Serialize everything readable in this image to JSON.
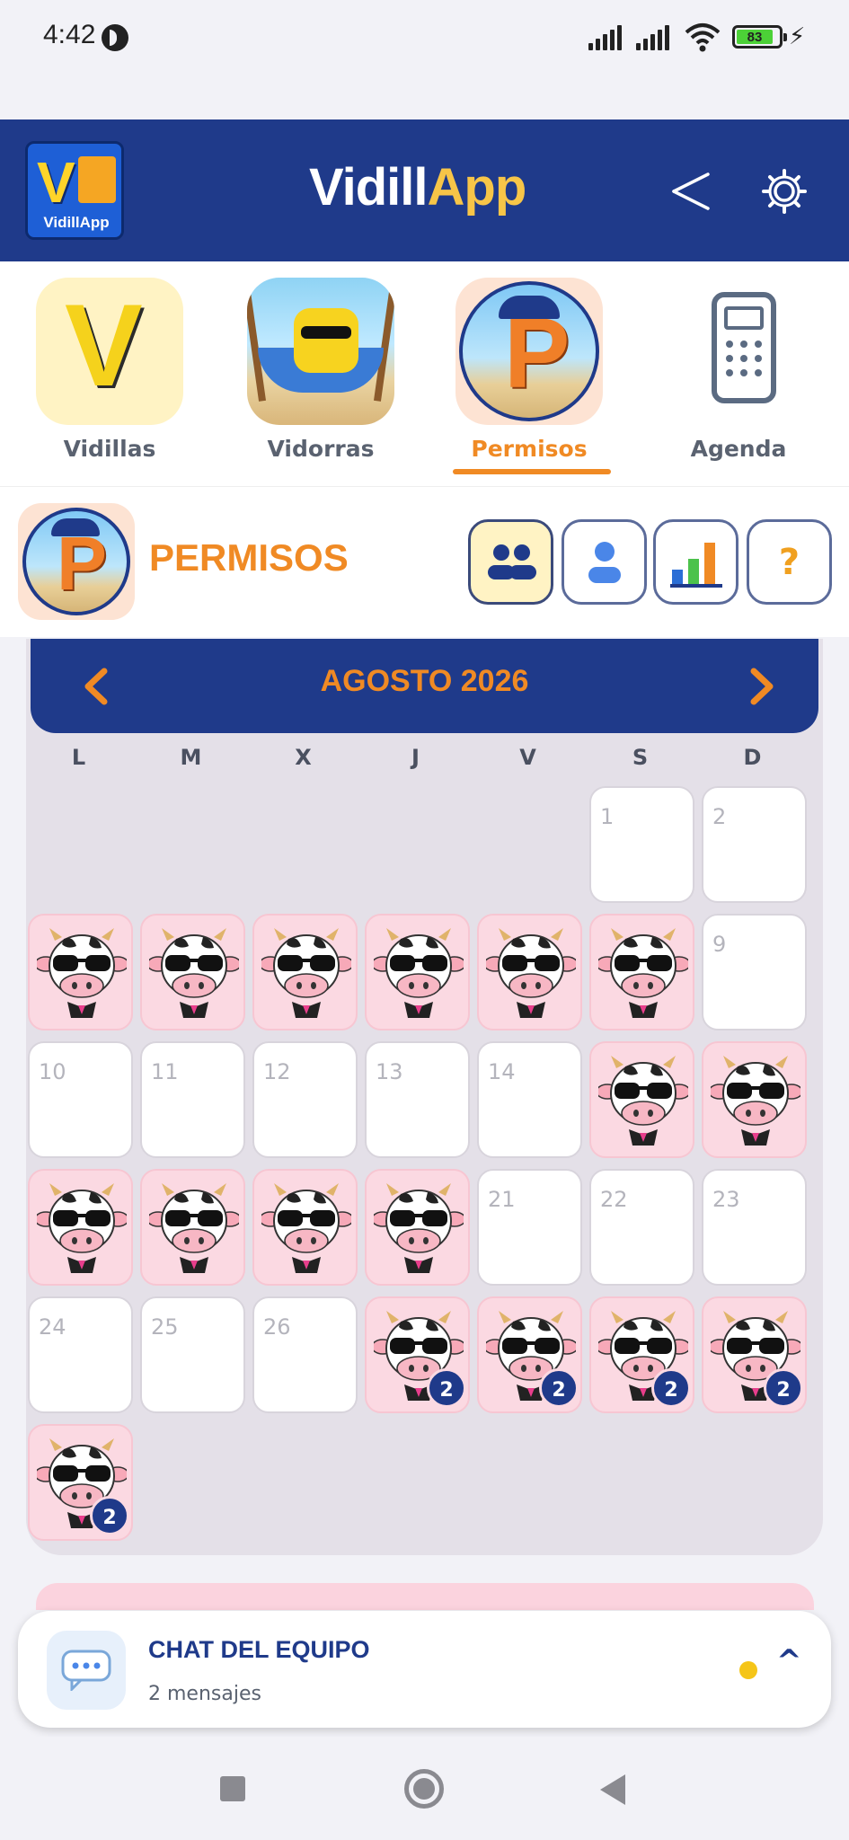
{
  "status": {
    "time": "4:42",
    "battery": "83"
  },
  "header": {
    "brand_white": "Vidill",
    "brand_orange": "App",
    "logo_text": "VidillApp"
  },
  "nav": [
    {
      "label": "Vidillas",
      "icon": "vidillas-v-mascot-icon"
    },
    {
      "label": "Vidorras",
      "icon": "vidorras-hammock-mascot-icon"
    },
    {
      "label": "Permisos",
      "icon": "permisos-p-mascot-icon",
      "active": true
    },
    {
      "label": "Agenda",
      "icon": "phone-icon"
    }
  ],
  "section": {
    "title": "PERMISOS",
    "help_label": "?"
  },
  "calendar": {
    "month_label": "AGOSTO 2026",
    "weekdays": [
      "L",
      "M",
      "X",
      "J",
      "V",
      "S",
      "D"
    ],
    "rows": [
      [
        null,
        null,
        null,
        null,
        null,
        {
          "day": "1"
        },
        {
          "day": "2"
        }
      ],
      [
        {
          "cow": true
        },
        {
          "cow": true
        },
        {
          "cow": true
        },
        {
          "cow": true
        },
        {
          "cow": true
        },
        {
          "cow": true
        },
        {
          "day": "9"
        }
      ],
      [
        {
          "day": "10"
        },
        {
          "day": "11"
        },
        {
          "day": "12"
        },
        {
          "day": "13"
        },
        {
          "day": "14"
        },
        {
          "cow": true
        },
        {
          "cow": true
        }
      ],
      [
        {
          "cow": true
        },
        {
          "cow": true
        },
        {
          "cow": true
        },
        {
          "cow": true
        },
        {
          "day": "21"
        },
        {
          "day": "22"
        },
        {
          "day": "23"
        }
      ],
      [
        {
          "day": "24"
        },
        {
          "day": "25"
        },
        {
          "day": "26"
        },
        {
          "cow": true,
          "badge": "2"
        },
        {
          "cow": true,
          "badge": "2"
        },
        {
          "cow": true,
          "badge": "2"
        },
        {
          "cow": true,
          "badge": "2"
        }
      ],
      [
        {
          "cow": true,
          "badge": "2"
        },
        null,
        null,
        null,
        null,
        null,
        null
      ]
    ]
  },
  "chat": {
    "title": "CHAT DEL EQUIPO",
    "subtitle": "2 mensajes",
    "expand": "^"
  },
  "colors": {
    "primary": "#1f3a8a",
    "accent": "#f08a24",
    "cow_bg": "#fbd9e2"
  }
}
